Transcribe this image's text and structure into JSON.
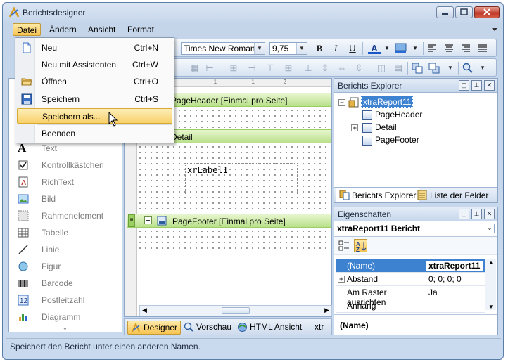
{
  "window": {
    "title": "Berichtsdesigner"
  },
  "menubar": [
    "Datei",
    "Ändern",
    "Ansicht",
    "Format"
  ],
  "file_menu": {
    "items": [
      {
        "label": "Neu",
        "shortcut": "Ctrl+N",
        "icon": "new-document-icon"
      },
      {
        "label": "Neu mit Assistenten",
        "shortcut": "Ctrl+W",
        "icon": ""
      },
      {
        "label": "Öffnen",
        "shortcut": "Ctrl+O",
        "icon": "open-folder-icon"
      },
      {
        "label": "Speichern",
        "shortcut": "Ctrl+S",
        "icon": "save-icon"
      },
      {
        "label": "Speichern als...",
        "shortcut": "",
        "icon": ""
      },
      {
        "label": "Beenden",
        "shortcut": "",
        "icon": ""
      }
    ]
  },
  "toolbar": {
    "font": "Times New Roman",
    "size": "9,75",
    "bold": "B",
    "italic": "I",
    "underline": "U",
    "fontcolor": "A"
  },
  "toolbox": {
    "items": [
      "Text",
      "Kontrollkästchen",
      "RichText",
      "Bild",
      "Rahmenelement",
      "Tabelle",
      "Linie",
      "Figur",
      "Barcode",
      "Postleitzahl",
      "Diagramm"
    ]
  },
  "designer": {
    "bands": {
      "page_header": "PageHeader [Einmal pro Seite]",
      "detail": "Detail",
      "page_footer": "PageFooter [Einmal pro Seite]"
    },
    "label": "xrLabel1"
  },
  "bottom_tabs": [
    "Designer",
    "Vorschau",
    "HTML Ansicht",
    "xtr"
  ],
  "report_explorer": {
    "title": "Berichts Explorer",
    "nodes": [
      "xtraReport11",
      "PageHeader",
      "Detail",
      "PageFooter"
    ],
    "tabs": [
      "Berichts Explorer",
      "Liste  der Felder"
    ]
  },
  "properties": {
    "title": "Eigenschaften",
    "object": "xtraReport11   Bericht",
    "rows": [
      {
        "name": "(Name)",
        "value": "xtraReport11"
      },
      {
        "name": "Abstand",
        "value": "0; 0; 0; 0"
      },
      {
        "name": "Am Raster ausrichten",
        "value": "Ja"
      },
      {
        "name": "Anhang",
        "value": ""
      }
    ],
    "description": "(Name)"
  },
  "status": "Speichert den Bericht unter einen anderen Namen."
}
